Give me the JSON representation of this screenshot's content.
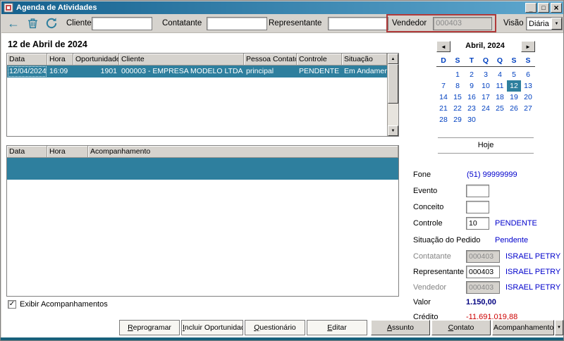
{
  "colors": {
    "titlebar_left": "#15618E",
    "titlebar_right": "#5FA8CF",
    "selection_teal": "#2E7F9E",
    "link_blue": "#0000CC",
    "calendar_blue": "#0040C0",
    "valor_navy": "#000080",
    "credit_red": "#CC0000",
    "annotation_red": "#B03A3A",
    "chrome_gray": "#D6D3CE"
  },
  "icons": {
    "back": "←",
    "minimize": "_",
    "maximize": "□",
    "close": "×",
    "combo_arrow": "▼",
    "scroll_up": "▲",
    "scroll_down": "▼",
    "cal_prev": "◄",
    "cal_next": "►",
    "check": "✓",
    "more_arrow": "▼"
  },
  "window": {
    "title": "Agenda de Atividades"
  },
  "toolbar": {
    "cliente_label": "Cliente",
    "contatante_label": "Contatante",
    "representante_label": "Representante",
    "vendedor_label": "Vendedor",
    "vendedor_value": "000403",
    "visao_label": "Visão",
    "visao_value": "Diária"
  },
  "date_header": "12 de Abril de 2024",
  "activities_table": {
    "columns": [
      "Data",
      "Hora",
      "Oportunidade",
      "Cliente",
      "Pessoa Contato",
      "Controle",
      "Situação"
    ],
    "rows": [
      [
        "12/04/2024",
        "16:09",
        "1901",
        "000003 - EMPRESA MODELO LTDA",
        "principal",
        "PENDENTE",
        "Em Andamento"
      ]
    ]
  },
  "followups_table": {
    "columns": [
      "Data",
      "Hora",
      "Acompanhamento"
    ]
  },
  "calendar": {
    "month": "Abril, 2024",
    "weekdays": [
      "D",
      "S",
      "T",
      "Q",
      "Q",
      "S",
      "S"
    ],
    "weeks": [
      [
        "",
        "1",
        "2",
        "3",
        "4",
        "5",
        "6"
      ],
      [
        "7",
        "8",
        "9",
        "10",
        "11",
        "12",
        "13"
      ],
      [
        "14",
        "15",
        "16",
        "17",
        "18",
        "19",
        "20"
      ],
      [
        "21",
        "22",
        "23",
        "24",
        "25",
        "26",
        "27"
      ],
      [
        "28",
        "29",
        "30",
        "",
        "",
        "",
        ""
      ]
    ],
    "selected_day": "12",
    "today_button": "Hoje"
  },
  "details": {
    "fone_label": "Fone",
    "fone_value": "(51) 99999999",
    "evento_label": "Evento",
    "conceito_label": "Conceito",
    "controle_label": "Controle",
    "controle_value": "10",
    "controle_status": "PENDENTE",
    "situacao_pedido_label": "Situação do Pedido",
    "situacao_pedido_value": "Pendente",
    "contatante_label": "Contatante",
    "contatante_code": "000403",
    "contatante_name": "ISRAEL PETRY",
    "representante_label": "Representante",
    "representante_code": "000403",
    "representante_name": "ISRAEL PETRY",
    "vendedor_label": "Vendedor",
    "vendedor_code": "000403",
    "vendedor_name": "ISRAEL PETRY",
    "valor_label": "Valor",
    "valor_value": "1.150,00",
    "credito_label": "Crédito",
    "credito_value": "-11.691.019,88"
  },
  "footer": {
    "checkbox_label": "Exibir Acompanhamentos",
    "checkbox_checked": true,
    "buttons": [
      {
        "name": "reprogramar-button",
        "label": "Reprogramar",
        "style": "flat",
        "underline_first": true
      },
      {
        "name": "incluir-oportunidade-button",
        "label": "Incluir Oportunidade",
        "style": "flat",
        "underline_first": true
      },
      {
        "name": "questionario-button",
        "label": "Questionário",
        "style": "flat",
        "underline_first": true
      },
      {
        "name": "editar-button",
        "label": "Editar",
        "style": "flat",
        "underline_first": true
      },
      {
        "name": "assunto-button",
        "label": "Assunto",
        "style": "gray",
        "underline_first": true
      },
      {
        "name": "contato-button",
        "label": "Contato",
        "style": "gray",
        "underline_first": true
      },
      {
        "name": "acompanhamentos-button",
        "label": "Acompanhamentos",
        "style": "gray",
        "underline_first": false
      }
    ]
  }
}
